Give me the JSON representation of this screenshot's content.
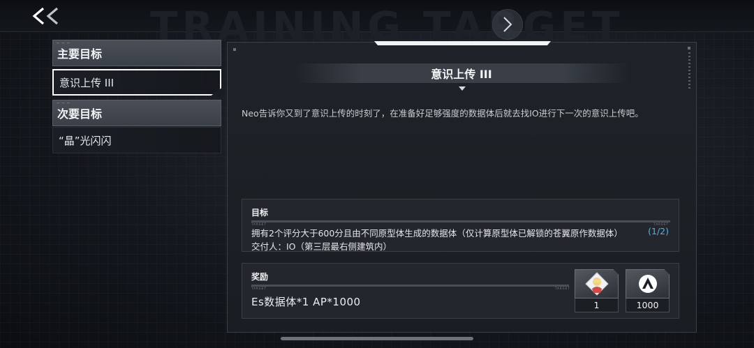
{
  "header": {
    "background_title": "TRAINING TARGET",
    "back_icon": "double-chevron-left-icon",
    "next_icon": "chevron-right-icon"
  },
  "quest_list": {
    "groups": [
      {
        "label": "主要目标",
        "items": [
          {
            "label": "意识上传 III",
            "selected": true
          }
        ]
      },
      {
        "label": "次要目标",
        "items": [
          {
            "label": "“晶”光闪闪",
            "selected": false
          }
        ]
      }
    ]
  },
  "detail": {
    "title": "意识上传 III",
    "description": "Neo告诉你又到了意识上传的时刻了，在准备好足够强度的数据体后就去找IO进行下一次的意识上传吧。",
    "target": {
      "label": "目标",
      "text": "拥有2个评分大于600分且由不同原型体生成的数据体（仅计算原型体已解锁的苍翼原作数据体）",
      "progress": "(1/2)",
      "giver": "交付人：IO（第三层最右侧建筑内）"
    },
    "reward": {
      "label": "奖励",
      "text": "Es数据体*1  AP*1000",
      "items": [
        {
          "icon": "character-portrait-icon",
          "count": "1"
        },
        {
          "icon": "ap-logo-icon",
          "count": "1000"
        }
      ]
    }
  },
  "colors": {
    "accent_progress": "#4fb3e6",
    "selected_border": "#ffffff"
  }
}
